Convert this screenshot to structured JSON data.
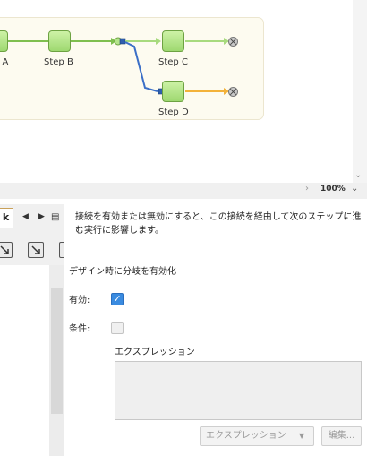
{
  "workflow": {
    "steps": [
      {
        "label": "p A"
      },
      {
        "label": "Step B"
      },
      {
        "label": "Step C"
      },
      {
        "label": "Step D"
      }
    ],
    "colors": {
      "node_fill": "#b4e48a",
      "line_green": "#7fbf4f",
      "line_blue": "#3b6fc7",
      "line_orange": "#f3b23a",
      "panel_bg": "#fdfbf0"
    }
  },
  "zoom": {
    "level": "100%",
    "scroll_right_icon": "chevron-right-icon",
    "dropdown_icon": "chevron-down-icon"
  },
  "left_panel": {
    "active_tab": "k",
    "tab_prev_icon": "triangle-left-icon",
    "tab_next_icon": "triangle-right-icon",
    "tab_list_icon": "list-icon"
  },
  "properties": {
    "description": "接続を有効または無効にすると、この接続を経由して次のステップに進む実行に影響します。",
    "design_toggle": "デザイン時に分岐を有効化",
    "enabled_label": "有効:",
    "enabled_checked": true,
    "condition_label": "条件:",
    "condition_checked": false,
    "expression_label": "エクスプレッション",
    "expression_value": "",
    "expression_dropdown": "エクスプレッション",
    "edit_button": "編集..."
  }
}
